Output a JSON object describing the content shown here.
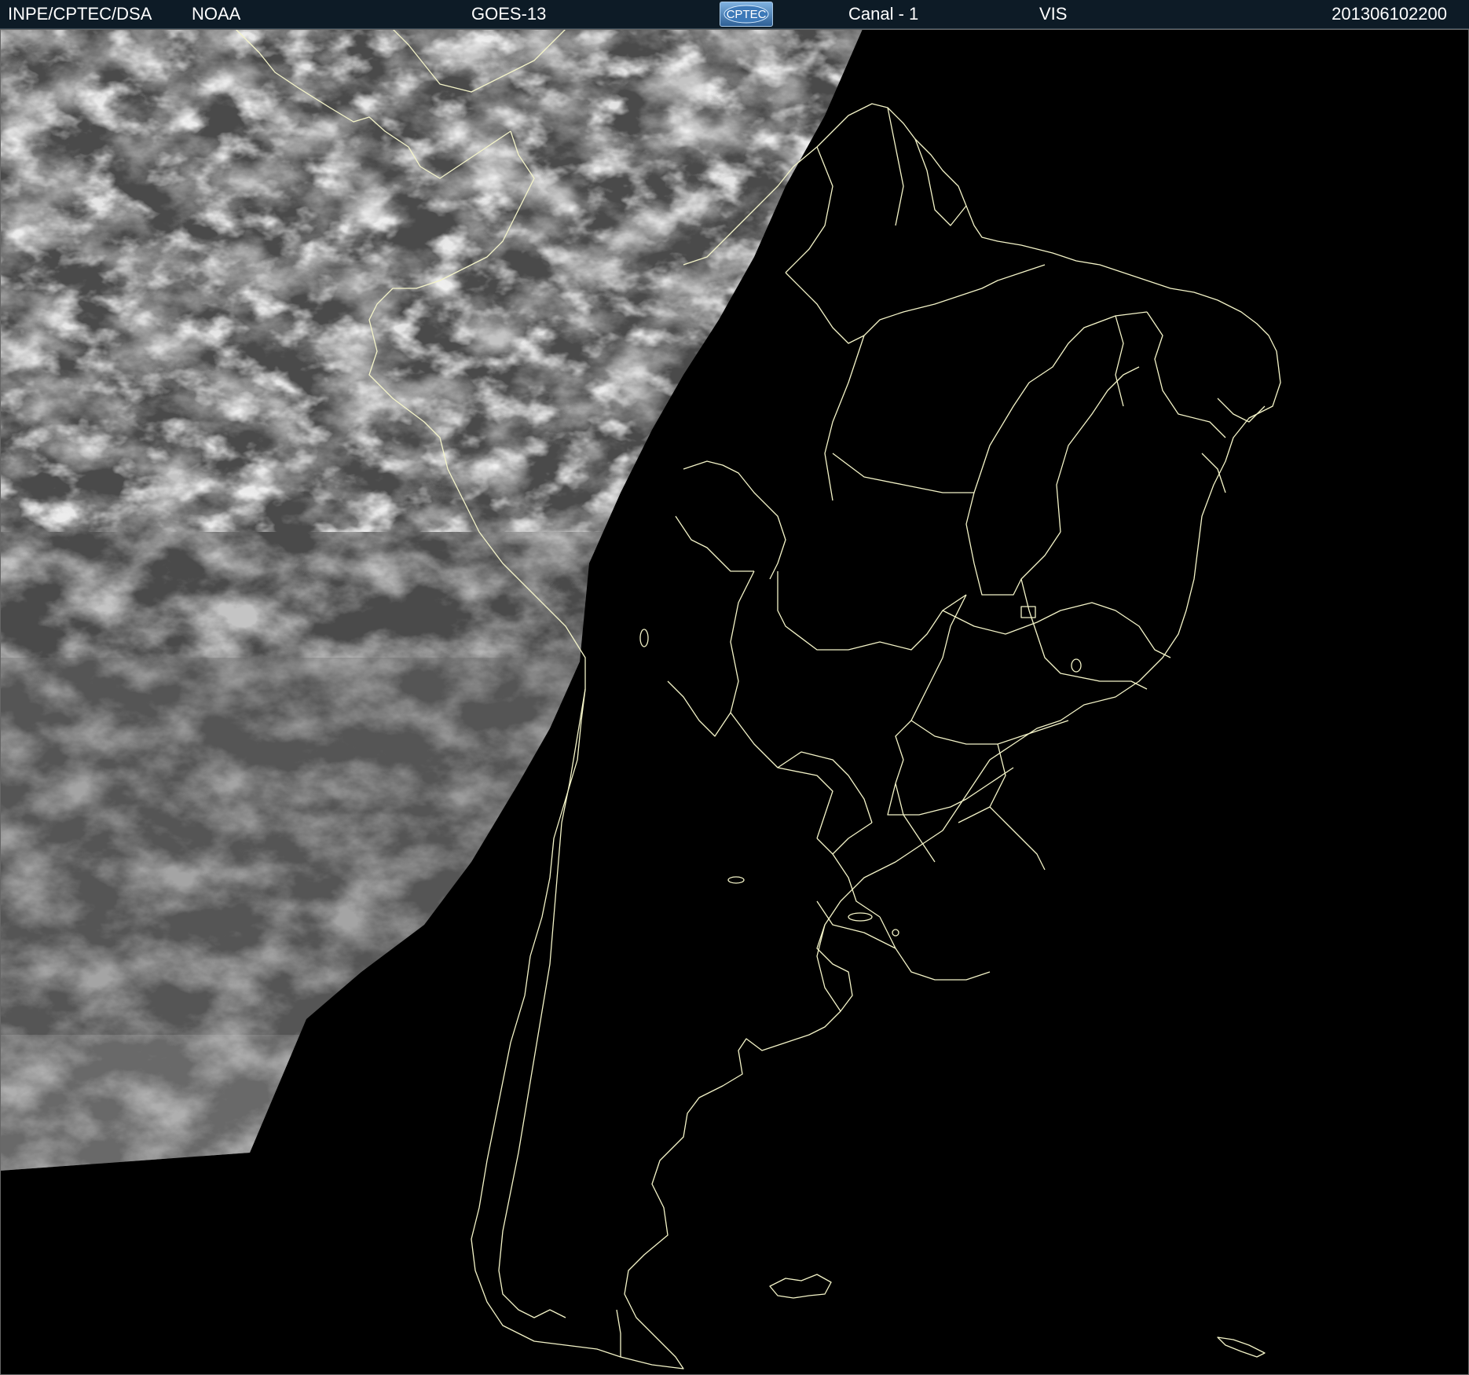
{
  "header": {
    "organization": "INPE/CPTEC/DSA",
    "agency": "NOAA",
    "satellite": "GOES-13",
    "logo_text": "CPTEC",
    "channel": "Canal - 1",
    "band": "VIS",
    "timestamp": "201306102200"
  },
  "colors": {
    "background": "#000000",
    "header_bg": "#0d1b26",
    "boundary_line": "#f4f4c8",
    "cloud_gray": "#9a9a9a"
  },
  "map": {
    "region": "South America",
    "imagery": "visible-channel clouds (daylight portion)"
  }
}
